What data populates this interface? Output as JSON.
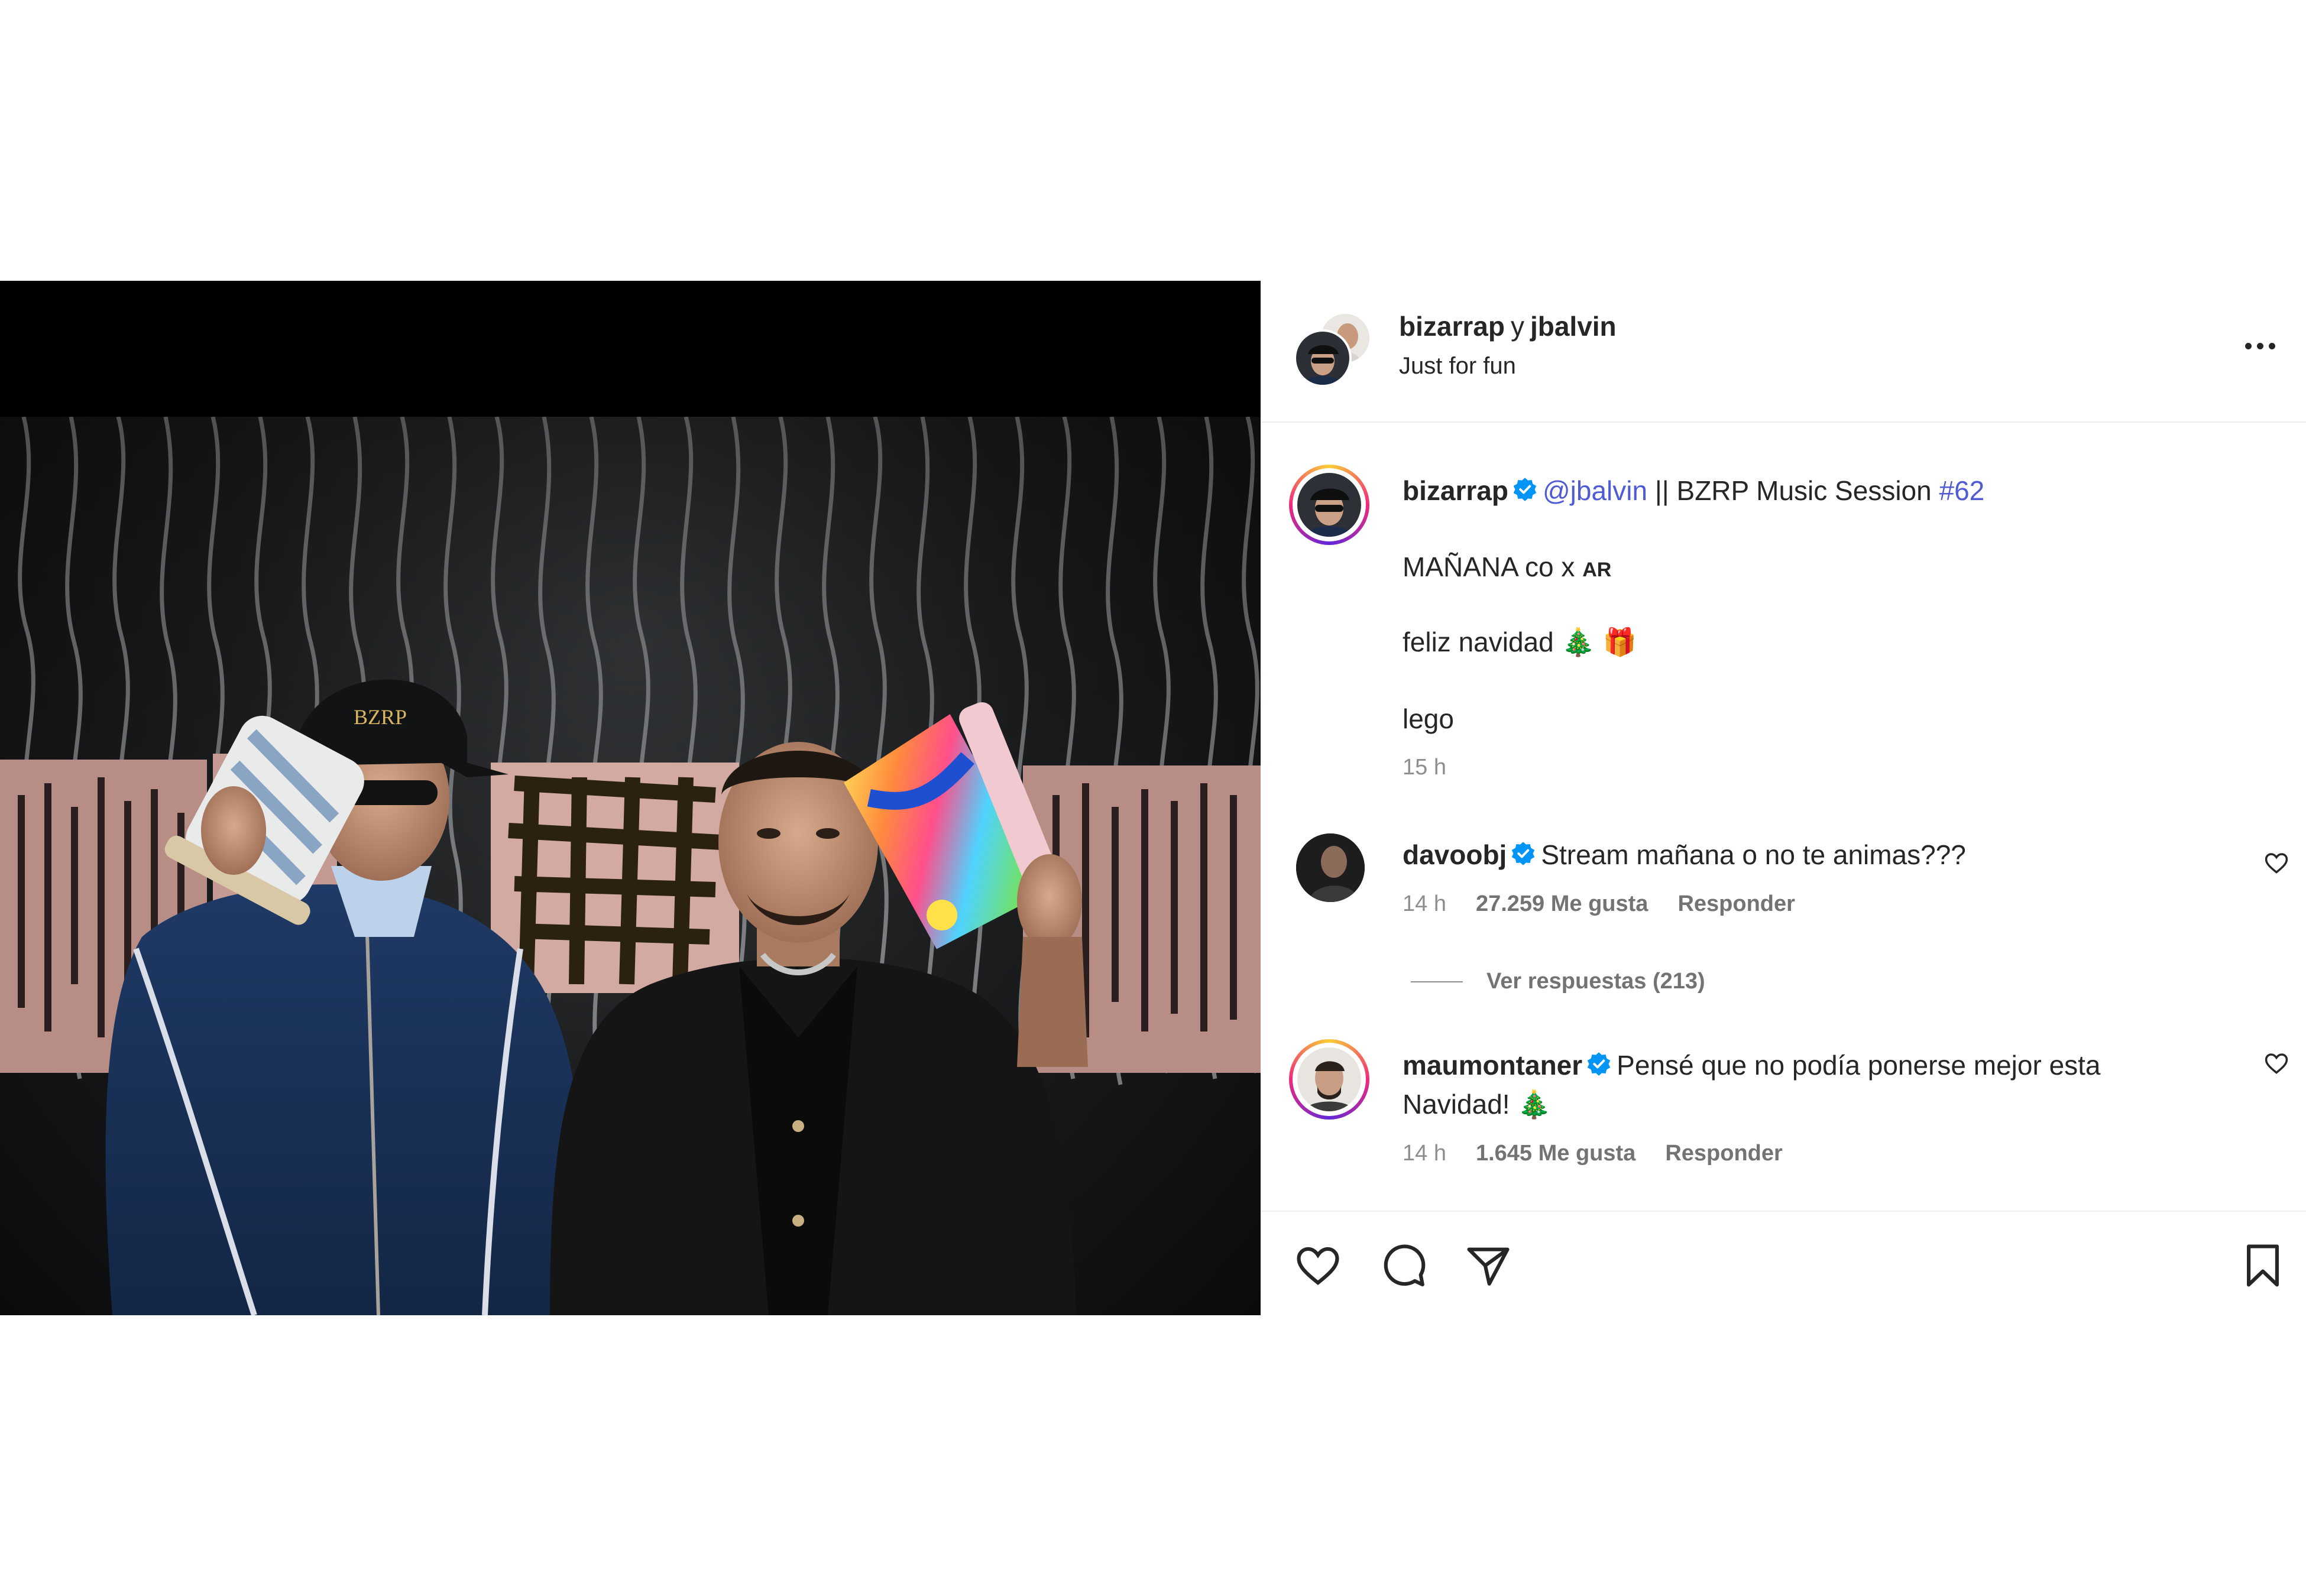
{
  "post": {
    "owners": {
      "primary": "bizarrap",
      "joiner": "y",
      "secondary": "jbalvin"
    },
    "subtitle": "Just for fun",
    "caption": {
      "author": "bizarrap",
      "mention": "@jbalvin",
      "text": "|| BZRP Music Session",
      "hashtag": "#62",
      "line2": "MAÑANA co x ",
      "line2_small": "AR",
      "line3": "feliz navidad 🎄 🎁",
      "line4": "lego",
      "time": "15 h"
    },
    "comments": [
      {
        "author": "davoobj",
        "text": "Stream mañana o no te animas???",
        "time": "14 h",
        "likes": "27.259 Me gusta",
        "reply": "Responder",
        "view_replies": "Ver respuestas (213)"
      },
      {
        "author": "maumontaner",
        "text_line1": "Pensé que no podía ponerse mejor esta",
        "text_line2": "Navidad! 🎄",
        "time": "14 h",
        "likes": "1.645 Me gusta",
        "reply": "Responder"
      }
    ],
    "photo": {
      "cap_text": "BZRP"
    }
  },
  "icons": {
    "more": "more-options-icon",
    "like": "heart-icon",
    "comment": "comment-bubble-icon",
    "share": "paper-plane-icon",
    "save": "bookmark-icon",
    "verified": "verified-badge-icon"
  },
  "colors": {
    "text": "#262626",
    "muted": "#8e8e8e",
    "link": "#4f5bd5",
    "verified": "#0095f6"
  }
}
